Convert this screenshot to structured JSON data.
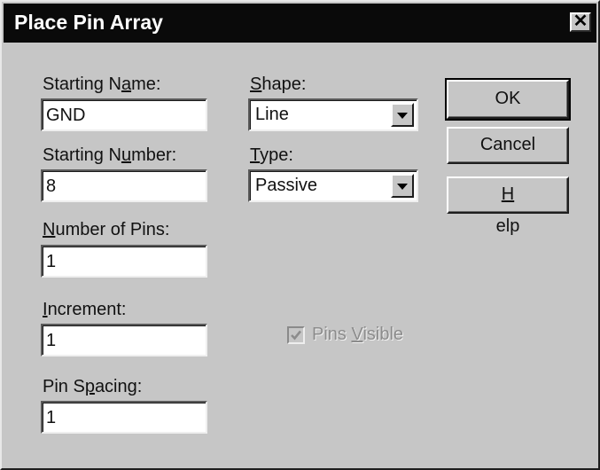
{
  "dialog": {
    "title": "Place Pin Array",
    "close_label": "✕"
  },
  "fields": {
    "starting_name": {
      "label_pre": "Starting N",
      "label_key": "a",
      "label_post": "me:",
      "value": "GND"
    },
    "starting_number": {
      "label_pre": "Starting N",
      "label_key": "u",
      "label_post": "mber:",
      "value": "8"
    },
    "number_of_pins": {
      "label_pre": "",
      "label_key": "N",
      "label_post": "umber of Pins:",
      "value": "1"
    },
    "increment": {
      "label_pre": "",
      "label_key": "I",
      "label_post": "ncrement:",
      "value": "1"
    },
    "pin_spacing": {
      "label_pre": "Pin S",
      "label_key": "p",
      "label_post": "acing:",
      "value": "1"
    }
  },
  "shape": {
    "label_pre": "",
    "label_key": "S",
    "label_post": "hape:",
    "value": "Line"
  },
  "type": {
    "label_pre": "",
    "label_key": "T",
    "label_post": "ype:",
    "value": "Passive"
  },
  "buttons": {
    "ok": "OK",
    "cancel": "Cancel",
    "help_key": "H",
    "help_post": "elp"
  },
  "pins_visible": {
    "label_pre": "Pins ",
    "label_key": "V",
    "label_post": "isible",
    "checked": true,
    "enabled": false
  },
  "colors": {
    "dialog_bg": "#c6c6c6",
    "titlebar_bg": "#0a0a0a",
    "title_text": "#ffffff",
    "disabled_text": "#8c8c8c"
  }
}
